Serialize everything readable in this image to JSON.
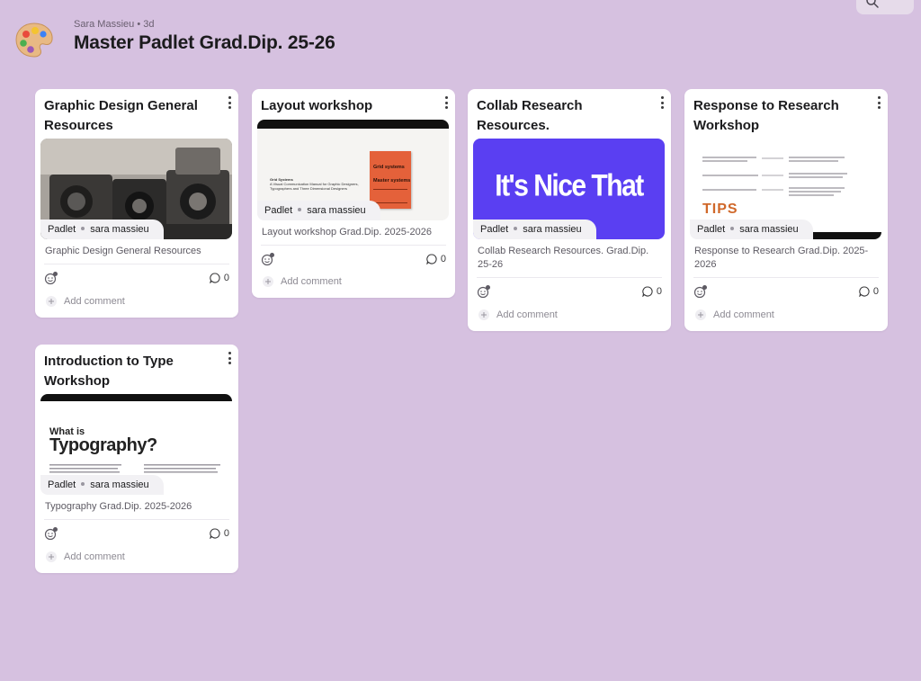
{
  "header": {
    "author": "Sara Massieu",
    "age": "3d",
    "title": "Master Padlet Grad.Dip. 25-26"
  },
  "colors": {
    "background": "#d6c1e0",
    "card": "#ffffff",
    "nice_that_purple": "#5a3ff2",
    "book_orange": "#e4613a"
  },
  "cards": [
    {
      "title": "Graphic Design General Resources",
      "attribution_source": "Padlet",
      "attribution_author": "sara massieu",
      "description": "Graphic Design General Resources",
      "comment_count": "0",
      "add_comment": "Add comment",
      "thumb_icon": "cameras-photo"
    },
    {
      "title": "Layout workshop",
      "attribution_source": "Padlet",
      "attribution_author": "sara massieu",
      "description": "Layout workshop Grad.Dip. 2025-2026",
      "comment_count": "0",
      "add_comment": "Add comment",
      "thumb_book_title": "Grid systems",
      "thumb_book_title2": "Master systems",
      "thumb_left_title": "Grid Systems",
      "thumb_left_sub": "A Visual Communication Manual for Graphic Designers, Typographers and Three Dimensional Designers"
    },
    {
      "title": "Collab Research Resources.",
      "attribution_source": "Padlet",
      "attribution_author": "sara massieu",
      "description": "Collab Research Resources. Grad.Dip. 25-26",
      "comment_count": "0",
      "add_comment": "Add comment",
      "thumb_text": "It's Nice That"
    },
    {
      "title": "Response to Research Workshop",
      "attribution_source": "Padlet",
      "attribution_author": "sara massieu",
      "description": "Response to Research Grad.Dip. 2025-2026",
      "comment_count": "0",
      "add_comment": "Add comment",
      "thumb_text": "TIPS"
    },
    {
      "title": "Introduction to Type Workshop",
      "attribution_source": "Padlet",
      "attribution_author": "sara massieu",
      "description": "Typography Grad.Dip. 2025-2026",
      "comment_count": "0",
      "add_comment": "Add comment",
      "thumb_small": "What is",
      "thumb_big": "Typography?"
    }
  ]
}
